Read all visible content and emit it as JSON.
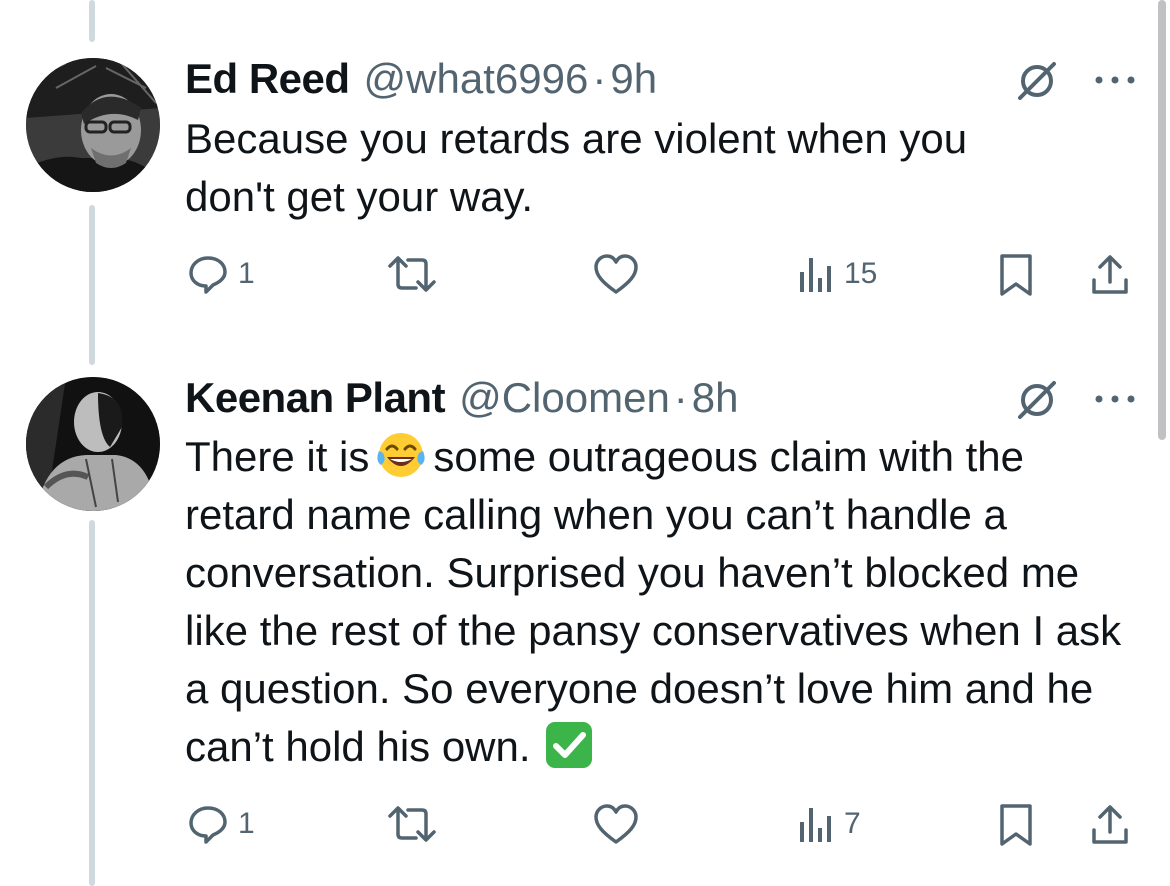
{
  "tweets": [
    {
      "name": "Ed Reed",
      "handle": "@what6996",
      "separator": "·",
      "time": "9h",
      "text": "Because you retards are violent when you don't get your way.",
      "reply_count": "1",
      "views_count": "15"
    },
    {
      "name": "Keenan Plant",
      "handle": "@Cloomen",
      "separator": "·",
      "time": "8h",
      "text_before_emoji": "There it is",
      "text_after_emoji": "some outrageous claim with the retard name calling when you can’t handle a conversation. Surprised you haven’t blocked me like the rest of the pansy conservatives when I ask a question. So everyone doesn’t love him and he can’t hold his own.",
      "reply_count": "1",
      "views_count": "7"
    }
  ],
  "icons": {
    "reply": "speech-bubble",
    "retweet": "retweet-arrows",
    "like": "heart",
    "views": "bar-chart",
    "bookmark": "bookmark",
    "share": "share-upload",
    "grok": "grok-slash-circle",
    "more": "ellipsis",
    "emoji_laugh": "face-with-tears-of-joy",
    "emoji_check": "check-mark-button"
  },
  "colors": {
    "text": "#0f1419",
    "muted": "#536471",
    "thread_line": "#cfd9de",
    "check_green": "#3bb54a",
    "emoji_yellow": "#ffcc33"
  }
}
